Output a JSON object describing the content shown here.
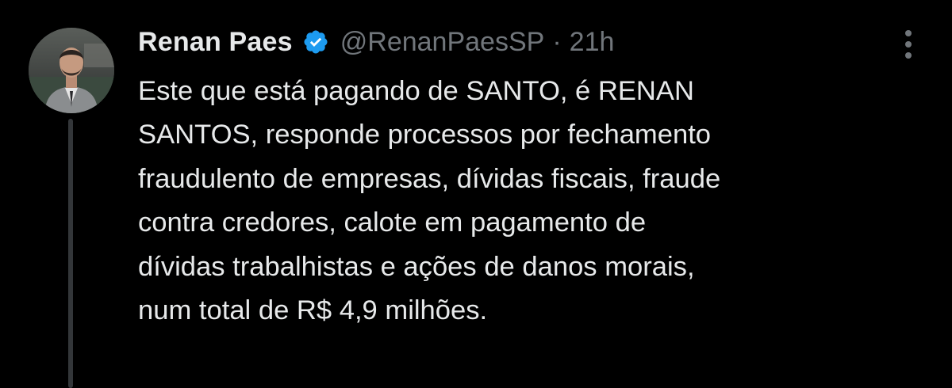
{
  "author": {
    "display_name": "Renan Paes",
    "handle": "@RenanPaesSP",
    "separator": "·",
    "timestamp": "21h",
    "verified": true
  },
  "avatar_icon": "profile-photo",
  "verified_icon": "verified-badge-icon",
  "more_icon": "more-options-icon",
  "colors": {
    "background": "#000000",
    "primary_text": "#e7e9ea",
    "secondary_text": "#71767b",
    "verified_blue": "#1d9bf0",
    "thread_line": "#333639"
  },
  "tweet": {
    "lines": [
      "Este que está pagando de SANTO, é RENAN",
      "SANTOS, responde processos por fechamento",
      "fraudulento de empresas, dívidas fiscais, fraude",
      "contra credores, calote em pagamento de",
      "dívidas trabalhistas e ações de danos morais,",
      "num total de R$ 4,9 milhões."
    ]
  }
}
